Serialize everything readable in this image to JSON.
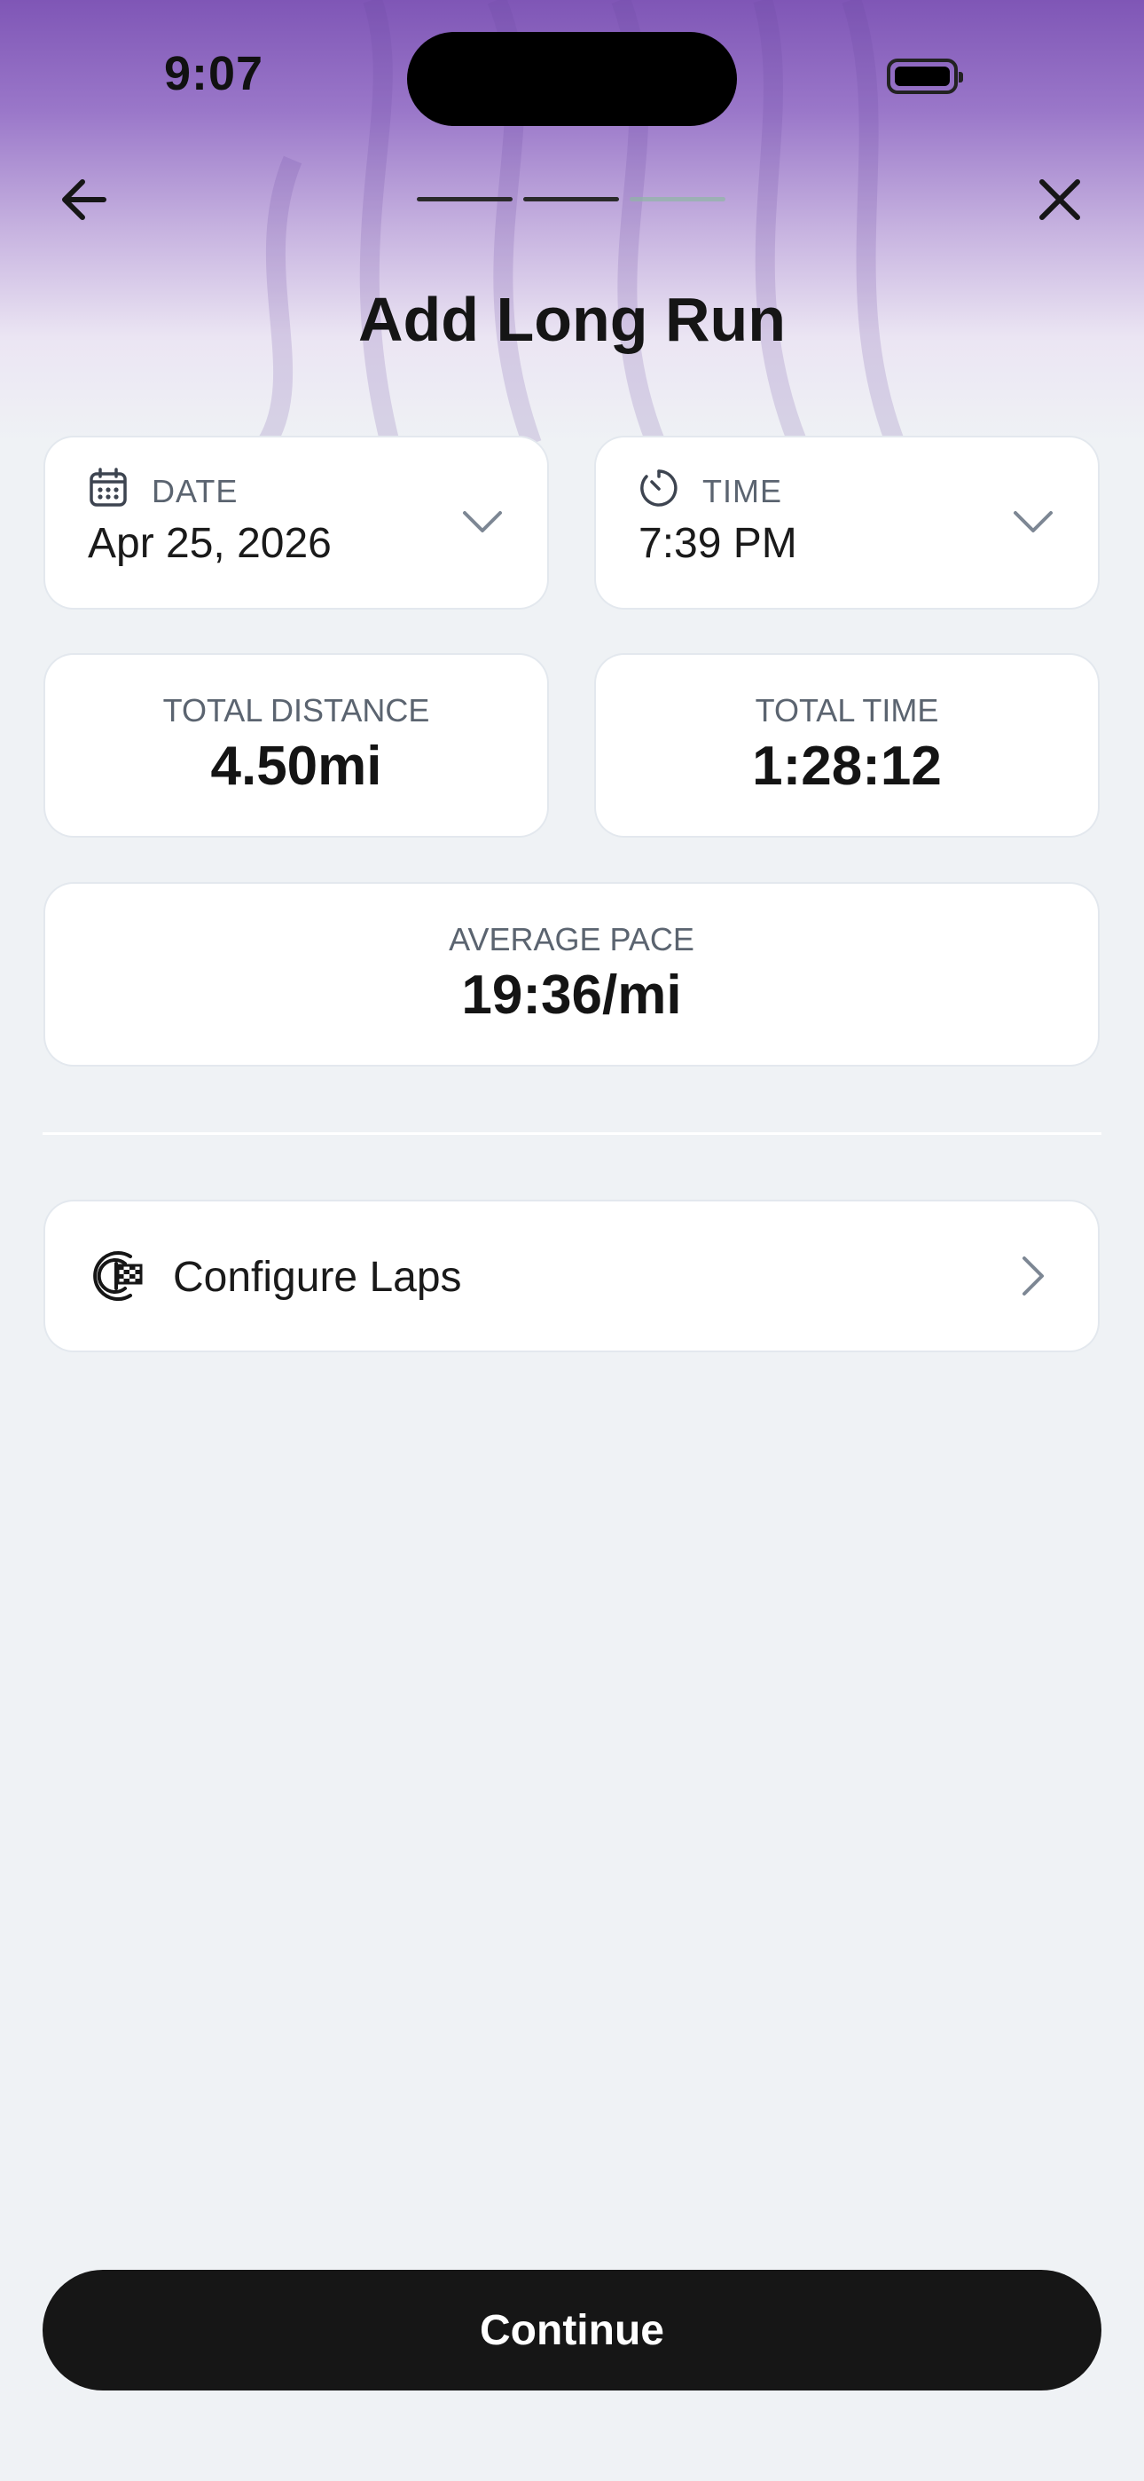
{
  "status_bar": {
    "time": "9:07"
  },
  "header": {
    "title": "Add Long Run",
    "progress": {
      "total_steps": 3,
      "completed_steps": 2
    }
  },
  "pickers": {
    "date": {
      "label": "DATE",
      "value": "Apr 25, 2026",
      "icon": "calendar-icon"
    },
    "time": {
      "label": "TIME",
      "value": "7:39 PM",
      "icon": "clock-icon"
    }
  },
  "stats": {
    "total_distance": {
      "label": "TOTAL DISTANCE",
      "value": "4.50mi"
    },
    "total_time": {
      "label": "TOTAL TIME",
      "value": "1:28:12"
    },
    "average_pace": {
      "label": "AVERAGE PACE",
      "value": "19:36/mi"
    }
  },
  "laps": {
    "label": "Configure Laps",
    "icon": "laps-flag-icon"
  },
  "footer": {
    "continue_label": "Continue"
  },
  "colors": {
    "hero_top": "#7f56b6",
    "background": "#eff2f5",
    "button": "#161616",
    "progress_done": "#2a2a2a",
    "progress_pending": "#8fb5a4"
  }
}
